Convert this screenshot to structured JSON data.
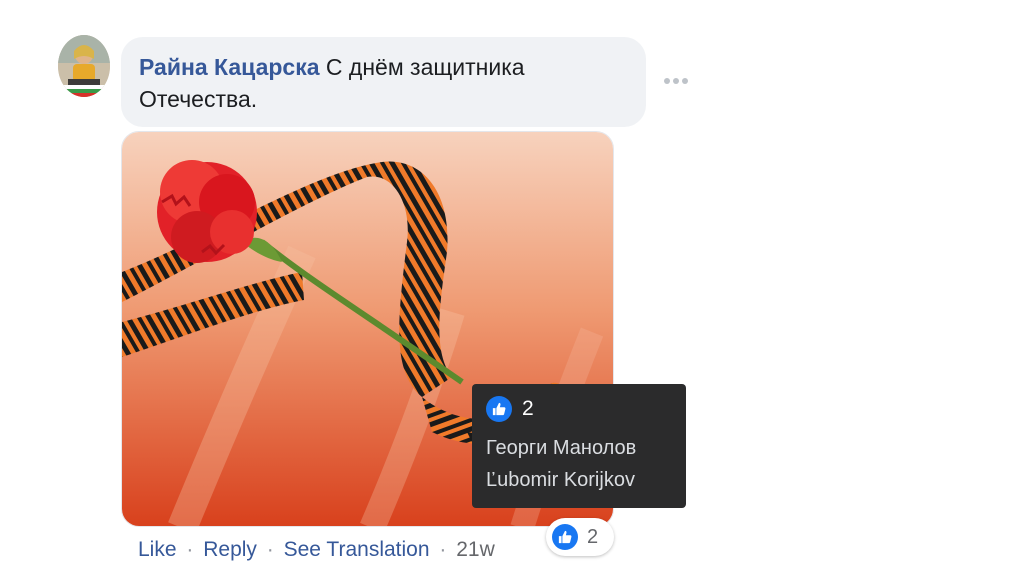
{
  "comment": {
    "author": "Райна Кацарска",
    "text_line1": " С днём защитника",
    "text_line2": "Отечества.",
    "timestamp": "21w"
  },
  "actions": {
    "like": "Like",
    "reply": "Reply",
    "see_translation": "See Translation",
    "separator": "·"
  },
  "reactions": {
    "type": "like-icon",
    "count": "2",
    "tooltip_count": "2",
    "people": [
      "Георги Манолов",
      "Ľubomir Korijkov"
    ]
  },
  "colors": {
    "author_link": "#365899",
    "like_blue": "#1877f2",
    "bubble_bg": "#f0f2f5",
    "tooltip_bg": "#2b2b2c",
    "ribbon_orange": "#f07a2a",
    "ribbon_black": "#1a1a1a",
    "carnation_red": "#e8242b"
  }
}
